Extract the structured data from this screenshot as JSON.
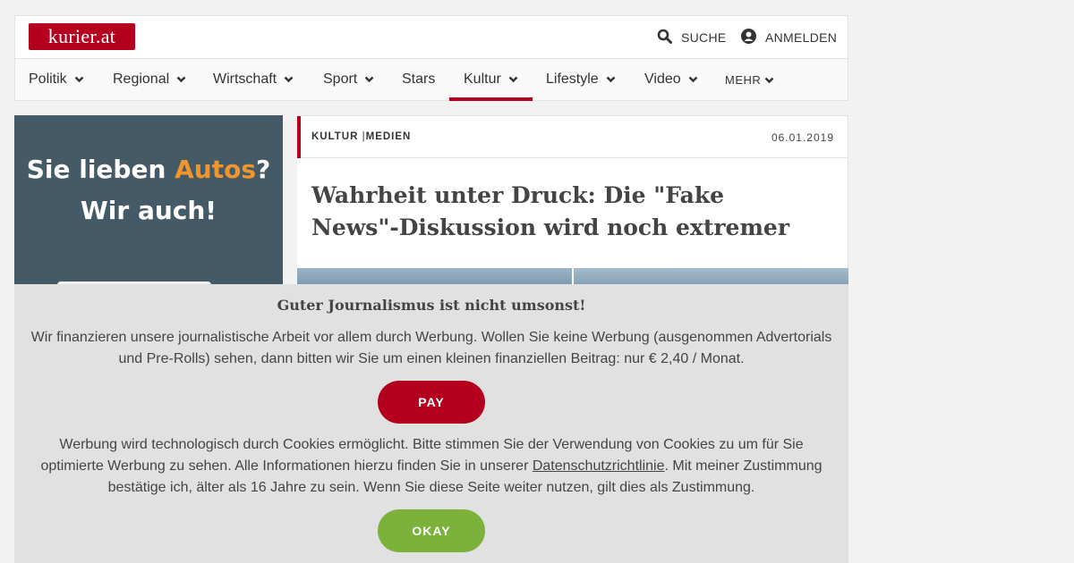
{
  "header": {
    "logo_text": "kurier.at",
    "search_label": "SUCHE",
    "login_label": "ANMELDEN"
  },
  "nav": {
    "items": [
      {
        "label": "Politik"
      },
      {
        "label": "Regional"
      },
      {
        "label": "Wirtschaft"
      },
      {
        "label": "Sport"
      },
      {
        "label": "Stars"
      },
      {
        "label": "Kultur"
      },
      {
        "label": "Lifestyle"
      },
      {
        "label": "Video"
      },
      {
        "label": "MEHR"
      }
    ],
    "active": "Kultur"
  },
  "ad": {
    "line1_pre": "Sie lieben ",
    "line1_highlight": "Autos",
    "line1_post": "?",
    "line2": "Wir auch!"
  },
  "article": {
    "kicker_section": "KULTUR",
    "kicker_separator": "|",
    "kicker_sub": "MEDIEN",
    "date": "06.01.2019",
    "headline": "Wahrheit unter Druck: Die \"Fake News\"-Diskussion wird noch extremer"
  },
  "overlay": {
    "title": "Guter Journalismus ist nicht umsonst!",
    "text1": "Wir finanzieren unsere journalistische Arbeit vor allem durch Werbung. Wollen Sie keine Werbung (ausgenommen Advertorials und Pre-Rolls) sehen, dann bitten wir Sie um einen kleinen finanziellen Beitrag: nur € 2,40 / Monat.",
    "pay_label": "PAY",
    "text2_pre": "Werbung wird technologisch durch Cookies ermöglicht. Bitte stimmen Sie der Verwendung von Cookies zu um für Sie optimierte Werbung zu sehen. Alle Informationen hierzu finden Sie in unserer ",
    "text2_link": "Datenschutzrichtlinie",
    "text2_post": ". Mit meiner Zustimmung bestätige ich, älter als 16 Jahre zu sein. Wenn Sie diese Seite weiter nutzen, gilt dies als Zustimmung.",
    "okay_label": "OKAY"
  },
  "colors": {
    "brand_red": "#b4001e",
    "okay_green": "#7cb13b",
    "ad_bg": "#455a67",
    "ad_highlight": "#f0952b"
  }
}
